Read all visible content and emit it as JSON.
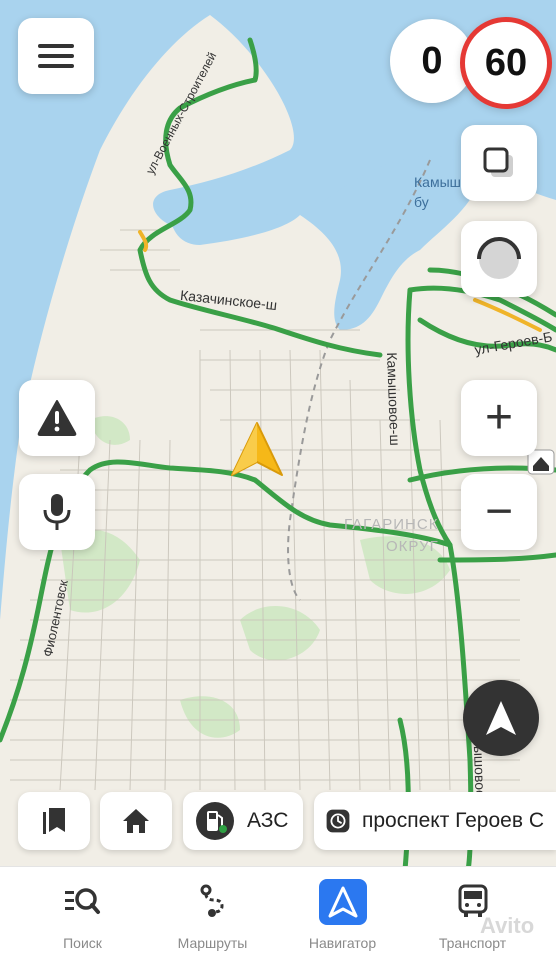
{
  "speed": {
    "current": "0",
    "limit": "60"
  },
  "map_labels": {
    "street_voennykh": "ул-Военных-Строителей",
    "street_kazachinskoe": "Казачинское-ш",
    "street_kamyshovoe": "Камышовое-ш",
    "street_geroev": "ул-Героев-Б",
    "street_fiolentovskoe": "Фиолентовск",
    "street_kamyshovoe_lower": "Камышовое",
    "bay": "Камыш бу",
    "district_line1": "ГАГАРИНСК",
    "district_line2": "ОКРУГ"
  },
  "buttons": {
    "menu": "menu-icon",
    "layers": "layers-icon",
    "profile": "profile-icon",
    "hazard": "warning-icon",
    "voice": "microphone-icon",
    "zoom_in": "+",
    "zoom_out": "−",
    "compass": "compass-icon"
  },
  "quick_chips": {
    "gas_label": "АЗС",
    "destination_label": "проспект Героев С"
  },
  "tabs": [
    {
      "label": "Поиск",
      "icon": "search-icon"
    },
    {
      "label": "Маршруты",
      "icon": "route-icon"
    },
    {
      "label": "Навигатор",
      "icon": "navigator-icon",
      "active": true
    },
    {
      "label": "Транспорт",
      "icon": "bus-icon"
    }
  ],
  "watermark": "Avito",
  "colors": {
    "accent": "#2b78f0",
    "speed_limit_ring": "#e53935",
    "road_green": "#3aa047",
    "water": "#a9d3ee",
    "land": "#f1eee6"
  }
}
